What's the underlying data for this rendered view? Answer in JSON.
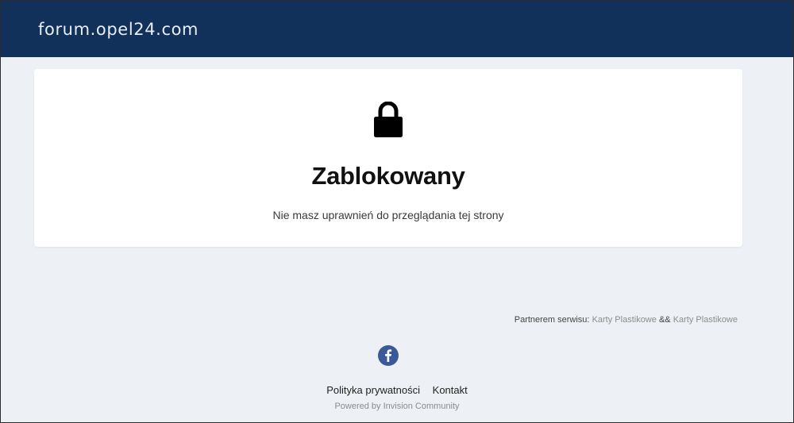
{
  "header": {
    "site_title": "forum.opel24.com"
  },
  "error": {
    "title": "Zablokowany",
    "message": "Nie masz uprawnień do przeglądania tej strony",
    "icon": "lock-icon"
  },
  "partner": {
    "prefix": "Partnerem serwisu:",
    "link1": "Karty Plastikowe",
    "separator": "&&",
    "link2": "Karty Plastikowe"
  },
  "social": {
    "icon": "facebook-icon",
    "color": "#3b5998"
  },
  "footer": {
    "links": [
      "Polityka prywatności",
      "Kontakt"
    ],
    "powered_by": "Powered by Invision Community"
  },
  "colors": {
    "header_bg": "#11305a",
    "page_bg": "#edf0f4",
    "card_bg": "#ffffff"
  }
}
